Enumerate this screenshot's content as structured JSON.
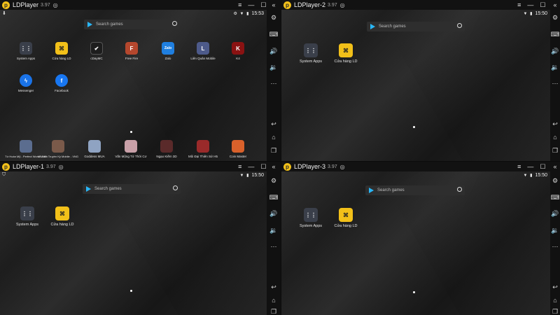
{
  "instances": [
    {
      "title": "LDPlayer",
      "version": "3.97",
      "time": "15:53",
      "search_placeholder": "Search games",
      "apps": [
        {
          "label": "System Apps",
          "icon": "grid-icon",
          "color": "#3a3f4a"
        },
        {
          "label": "Cửa hàng LD",
          "icon": "gamepad-icon",
          "color": "#f2c019"
        },
        {
          "label": "cDayMC",
          "icon": "check-icon",
          "color": "#1d1d1d"
        },
        {
          "label": "Free Fire",
          "icon": "game-icon",
          "color": "#b5472d"
        },
        {
          "label": "Zalo",
          "icon": "chat-icon",
          "color": "#1f7fe0"
        },
        {
          "label": "Liên Quân Mobile",
          "icon": "game-icon",
          "color": "#4d5a8a"
        },
        {
          "label": "K4",
          "icon": "game-icon",
          "color": "#8a1212"
        },
        {
          "label": "Messenger",
          "icon": "messenger-icon",
          "color": "#1a73e8"
        },
        {
          "label": "Facebook",
          "icon": "facebook-icon",
          "color": "#1877f2"
        }
      ],
      "dock": [
        {
          "label": "Tứ Hoàn Mỹ - Perfect World VNG",
          "color": "#5b6d8f"
        },
        {
          "label": "Võ Lâm Truyền Kỳ Mobile - VNG",
          "color": "#7a5a4a"
        },
        {
          "label": "Goddess MUA",
          "color": "#8fa3c2"
        },
        {
          "label": "Vấn Mộng Tử Thời Cơ",
          "color": "#c9a0a8"
        },
        {
          "label": "Ngạo Kiếm 3D",
          "color": "#5a2a2a"
        },
        {
          "label": "Mũi Đại Thiên Sứ H5",
          "color": "#9a2a2a"
        },
        {
          "label": "Coin Master",
          "color": "#d9612b"
        }
      ]
    },
    {
      "title": "LDPlayer-2",
      "version": "3.97",
      "time": "15:50",
      "search_placeholder": "Search games",
      "apps": [
        {
          "label": "System Apps",
          "icon": "grid-icon",
          "color": "#3a3f4a"
        },
        {
          "label": "Cửa hàng LD",
          "icon": "gamepad-icon",
          "color": "#f2c019"
        }
      ]
    },
    {
      "title": "LDPlayer-1",
      "version": "3.97",
      "time": "15:50",
      "search_placeholder": "Search games",
      "apps": [
        {
          "label": "System Apps",
          "icon": "grid-icon",
          "color": "#3a3f4a"
        },
        {
          "label": "Cửa hàng LD",
          "icon": "gamepad-icon",
          "color": "#f2c019"
        }
      ]
    },
    {
      "title": "LDPlayer-3",
      "version": "3.97",
      "time": "15:50",
      "search_placeholder": "Search games",
      "apps": [
        {
          "label": "System Apps",
          "icon": "grid-icon",
          "color": "#3a3f4a"
        },
        {
          "label": "Cửa hàng LD",
          "icon": "gamepad-icon",
          "color": "#f2c019"
        }
      ]
    }
  ],
  "window_controls": {
    "menu": "≡",
    "minimize": "—",
    "maximize": "☐",
    "close": "✕",
    "collapse": "«"
  },
  "sidebar_icons": [
    "gear-icon",
    "keyboard-icon",
    "volume-up-icon",
    "volume-down-icon",
    "more-icon",
    "back-icon",
    "home-icon",
    "recents-icon"
  ],
  "colors": {
    "accent": "#f2c019",
    "titlebar": "#121212",
    "sidebar": "#111111"
  }
}
